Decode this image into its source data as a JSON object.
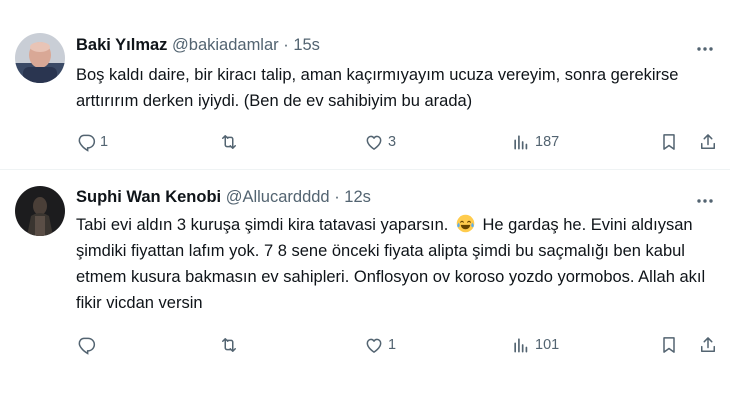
{
  "tweets": [
    {
      "name": "Baki Yılmaz",
      "handle": "@bakiadamlar",
      "dot": " · ",
      "time": "15s",
      "text_before_emoji": "Boş kaldı daire, bir kiracı talip, aman kaçırmıyayım ucuza vereyim, sonra gerekirse arttırırım derken iyiydi.  (Ben de ev sahibiyim bu arada)",
      "emoji": "",
      "text_after_emoji": "",
      "replies": "1",
      "retweets": "",
      "likes": "3",
      "views": "187"
    },
    {
      "name": "Suphi Wan Kenobi",
      "handle": "@Allucardddd",
      "dot": " · ",
      "time": "12s",
      "text_before_emoji": "Tabi evi aldın 3 kuruşa şimdi kira tatavasi yaparsın. ",
      "emoji": "face-with-tears-of-joy",
      "text_after_emoji": " He gardaş he. Evini aldıysan şimdiki fiyattan lafım yok. 7 8 sene önceki fiyata alipta şimdi bu saçmalığı ben kabul etmem kusura bakmasın ev sahipleri. Onflosyon ov koroso yozdo yormobos. Allah akıl fikir  vicdan versin",
      "replies": "",
      "retweets": "",
      "likes": "1",
      "views": "101"
    }
  ],
  "icons": {
    "more": "more-dots-icon",
    "reply": "reply-icon",
    "retweet": "retweet-icon",
    "like": "heart-icon",
    "views": "views-icon",
    "bookmark": "bookmark-icon",
    "share": "share-icon"
  },
  "colors": {
    "text": "#0f1419",
    "secondary": "#536471",
    "divider": "#eff3f4"
  }
}
